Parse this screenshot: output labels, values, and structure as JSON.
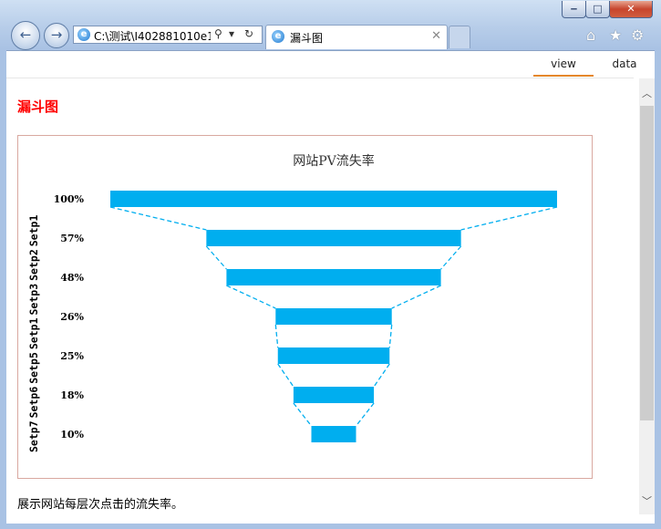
{
  "browser": {
    "address_url": "C:\\测试\\I402881010e1",
    "tab_title": "漏斗图",
    "favicon_letter": "e",
    "icons": [
      "back-arrow-icon",
      "forward-arrow-icon",
      "search-icon",
      "dropdown-icon",
      "refresh-icon",
      "tab-close-icon",
      "home-icon",
      "favorites-star-icon",
      "gear-icon"
    ]
  },
  "view_tabs": {
    "view": "view",
    "data": "data",
    "active": "view",
    "accent": "#e5872b"
  },
  "page": {
    "title": "漏斗图",
    "title_color": "#ff0000",
    "caption": "展示网站每层次点击的流失率。"
  },
  "chart_data": {
    "type": "funnel",
    "title": "网站PV流失率",
    "categories": [
      "Setp1",
      "Setp2",
      "Setp3",
      "Setp1",
      "Setp5",
      "Setp6",
      "Setp7"
    ],
    "values": [
      100,
      57,
      48,
      26,
      25,
      18,
      10
    ],
    "value_labels": [
      "100%",
      "57%",
      "48%",
      "26%",
      "25%",
      "18%",
      "10%"
    ],
    "bar_color": "#00aeef",
    "connector_style": "dashed",
    "xlim": [
      0,
      100
    ]
  }
}
